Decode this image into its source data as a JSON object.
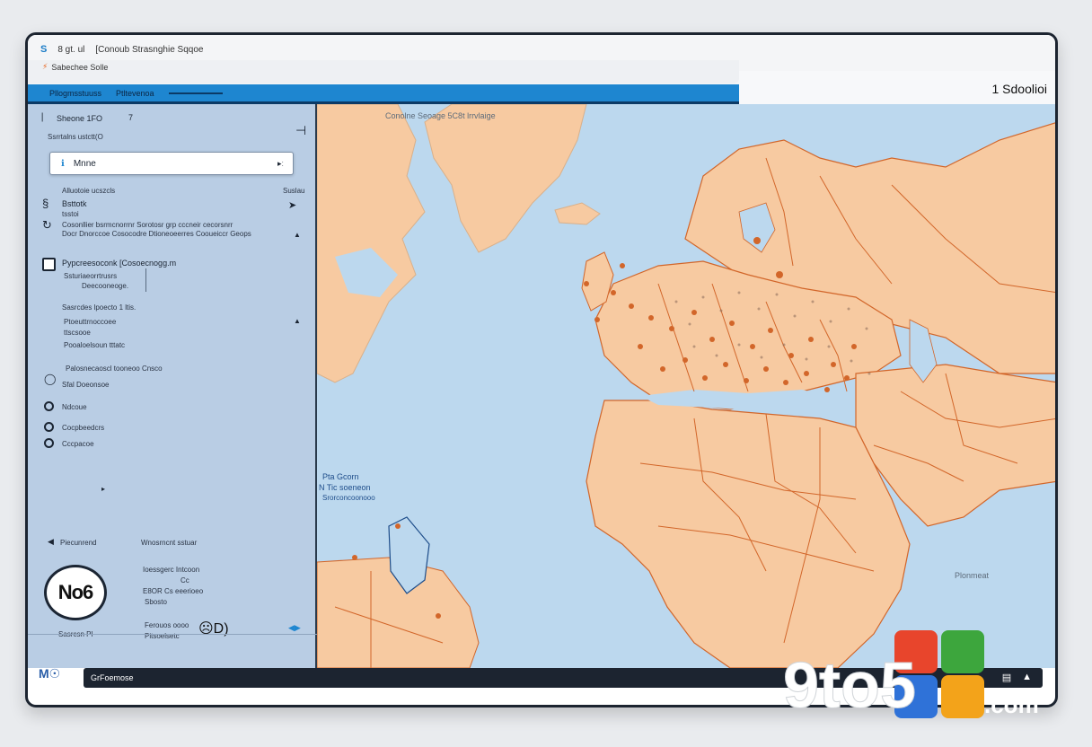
{
  "titlebar": {
    "app_icon": "S",
    "line1_left": "8 gt. ul",
    "line1_title": "[Conoub Strasnghie Sqqoe",
    "line2_text": "Sabechee Solle"
  },
  "bluebar": {
    "item1": "Pllogmsstuuss",
    "item2": "Ptltevenoa"
  },
  "rightbar": {
    "title": "1 Sdoolioi"
  },
  "sidebar": {
    "header": "Sheone 1FO",
    "header_right": "7",
    "subheader": "Ssrrtalns ustctt(O",
    "search_value": "Mnne",
    "search_caret": "▸ː",
    "section1_label": "Alluotoie ucszcls",
    "section1_right": "Suslau",
    "row1_title": "Bsttotk",
    "row1_sub": "tsstoi",
    "row2_line1": "Cosonllier bsrmcnorrnr Sorotosr grp cccneir cecorsnrr",
    "row2_line2": "Docr Dnorccoe Cosocodre Dtioneoeerres Cooueiccr Geops",
    "check_label": "Pypcreesoconk  [Cosoecnogg.m",
    "box_line1": "Ssturiaeorrtrusrs",
    "box_line2": "Deecooneoge.",
    "list1": "Sasrcdes lpoecto 1 ltis.",
    "list2": "Ptoeuttrnoccoee",
    "list3": "ttscsooe",
    "list4": "Pooaloelsoun tttatc",
    "list5": "Palosnecaoscl tooneoo  Cnsco",
    "list6": "Sfal Doeonsoe",
    "radio1": "Ndcoue",
    "radio2": "Cocpbeedcrs",
    "radio3": "Cccpacoe",
    "section2_left": "Piecunrend",
    "section2_right": "Wnosrncnt sstuar",
    "badge_text": "No6",
    "badge_caption": "Sasrcsn Pl",
    "info_line1": "Ioessgerc Intcoon",
    "info_line2": "Cc",
    "info_line3": "E8OR  Cs eeerioeo",
    "info_line4": "Sbosto",
    "info_line5": "Ferouos oooo",
    "info_line6": "Pitsoelsetc",
    "big_value": "☹D)",
    "footer_logo": "M☉"
  },
  "map": {
    "top_label": "Conolne Seoage 5C8t lrrvlaige",
    "left_label1": "Pta Gcorn",
    "left_label2": "N Tic soeneon",
    "left_label3": "Srorconcoonooo",
    "right_label": "Plonmeat"
  },
  "statusbar": {
    "text": "GrFoemose",
    "right_icon1": "▤",
    "right_icon2": "▲"
  },
  "watermark": {
    "text": "9to5",
    "suffix": ".com"
  },
  "colors": {
    "sidebar_bg": "#b9cde4",
    "map_water": "#bcd8ee",
    "map_land": "#f7caa1",
    "map_border": "#d2662a",
    "accent_blue": "#1e86d0",
    "status_bg": "#1c2430"
  }
}
